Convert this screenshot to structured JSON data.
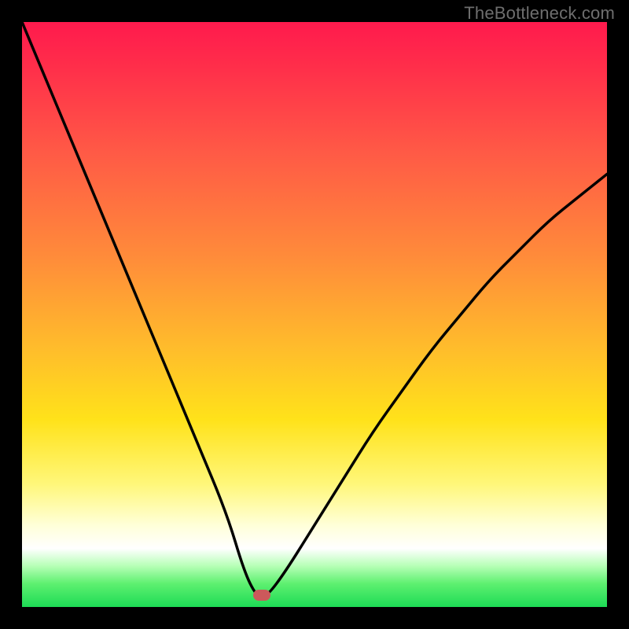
{
  "watermark": "TheBottleneck.com",
  "colors": {
    "frame": "#000000",
    "curve": "#000000",
    "marker": "#cc595b",
    "gradient_top": "#ff1a4d",
    "gradient_bottom": "#1ddb55"
  },
  "chart_data": {
    "type": "line",
    "title": "",
    "xlabel": "",
    "ylabel": "",
    "xlim": [
      0,
      100
    ],
    "ylim": [
      0,
      100
    ],
    "series": [
      {
        "name": "curve",
        "x": [
          0,
          5,
          10,
          15,
          20,
          25,
          30,
          35,
          38,
          40,
          41,
          42,
          45,
          50,
          55,
          60,
          65,
          70,
          75,
          80,
          85,
          90,
          95,
          100
        ],
        "y": [
          100,
          88,
          76,
          64,
          52,
          40,
          28,
          16,
          6,
          2,
          2,
          2,
          6,
          14,
          22,
          30,
          37,
          44,
          50,
          56,
          61,
          66,
          70,
          74
        ]
      }
    ],
    "marker": {
      "x": 41,
      "y": 2
    },
    "notes": "Gradient background from red (top) to green (bottom); black V-shaped curve; small rounded red marker at curve minimum."
  }
}
